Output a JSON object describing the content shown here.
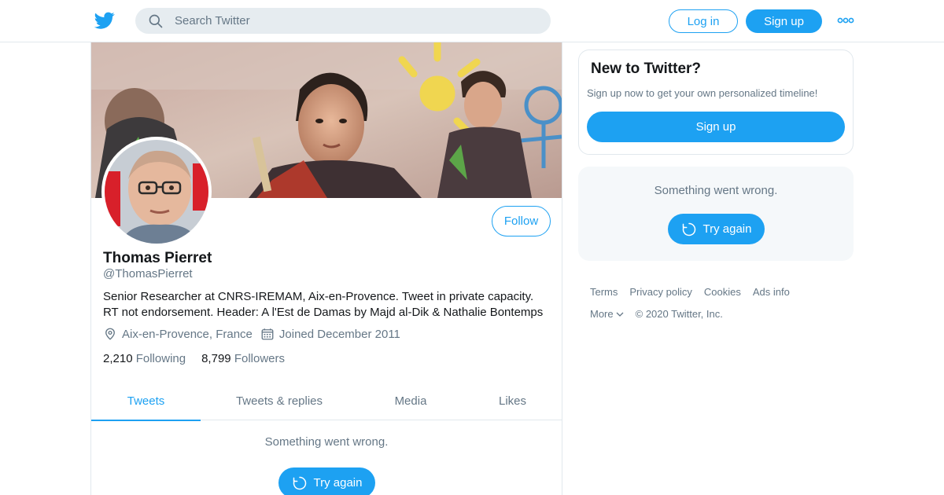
{
  "brand": {
    "accent": "#1da1f2",
    "icon": "twitter-bird-icon"
  },
  "header": {
    "search_placeholder": "Search Twitter",
    "login_label": "Log in",
    "signup_label": "Sign up"
  },
  "profile": {
    "name": "Thomas Pierret",
    "handle": "@ThomasPierret",
    "bio_line1": "Senior Researcher at CNRS-IREMAM, Aix-en-Provence. Tweet in private capacity.",
    "bio_line2": "RT not endorsement. Header: A l'Est de Damas by Majd al-Dik & Nathalie Bontemps",
    "location": "Aix-en-Provence, France",
    "joined": "Joined December 2011",
    "following_count": "2,210",
    "following_label": "Following",
    "followers_count": "8,799",
    "followers_label": "Followers",
    "follow_label": "Follow"
  },
  "tabs": [
    {
      "label": "Tweets",
      "active": true
    },
    {
      "label": "Tweets & replies",
      "active": false
    },
    {
      "label": "Media",
      "active": false
    },
    {
      "label": "Likes",
      "active": false
    }
  ],
  "timeline": {
    "error_text": "Something went wrong.",
    "retry_label": "Try again"
  },
  "sidebar": {
    "new_title": "New to Twitter?",
    "new_text": "Sign up now to get your own personalized timeline!",
    "signup_label": "Sign up",
    "error_text": "Something went wrong.",
    "retry_label": "Try again"
  },
  "footer": {
    "links": [
      "Terms",
      "Privacy policy",
      "Cookies",
      "Ads info"
    ],
    "more_label": "More",
    "copyright": "© 2020 Twitter, Inc."
  }
}
